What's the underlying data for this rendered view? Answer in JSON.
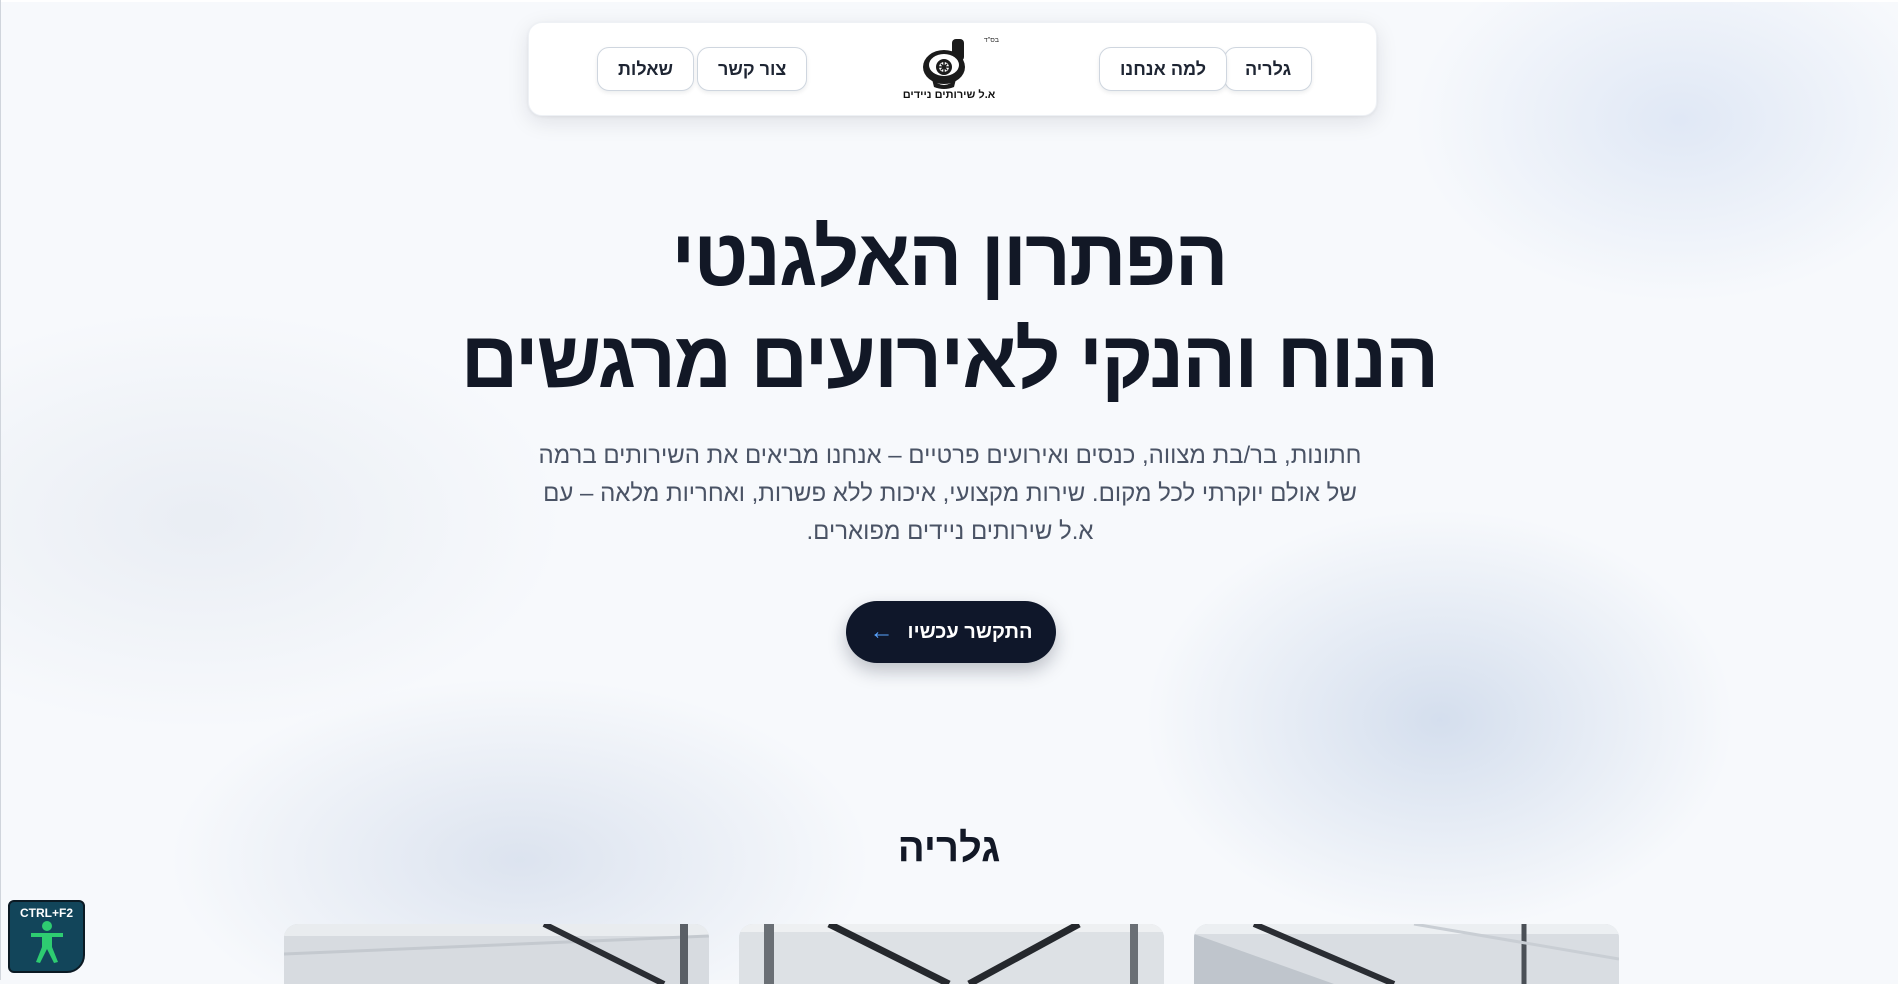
{
  "nav": {
    "items": [
      {
        "label": "גלריה"
      },
      {
        "label": "למה אנחנו"
      },
      {
        "label": "צור קשר"
      },
      {
        "label": "שאלות"
      }
    ],
    "logo": {
      "text": "א.ל שירותים ניידים",
      "bsd": "בס\"ד"
    }
  },
  "hero": {
    "title_line1": "הפתרון האלגנטי",
    "title_line2": "הנוח והנקי לאירועים מרגשים",
    "description": "חתונות, בר/בת מצווה, כנסים ואירועים פרטיים – אנחנו מביאים את השירותים ברמה של אולם יוקרתי לכל מקום. שירות מקצועי, איכות ללא פשרות, ואחריות מלאה – עם א.ל שירותים ניידים מפוארים.",
    "cta_label": "התקשר עכשיו",
    "cta_icon": "arrow-left-icon"
  },
  "gallery": {
    "title": "גלריה"
  },
  "accessibility": {
    "shortcut": "CTRL+F2",
    "icon": "accessibility-person-icon",
    "color": "#12455a",
    "figure_color": "#2ecc71"
  },
  "colors": {
    "primary_dark": "#0f172a",
    "accent_blue": "#5aa4ff",
    "text_muted": "#4a5365"
  }
}
